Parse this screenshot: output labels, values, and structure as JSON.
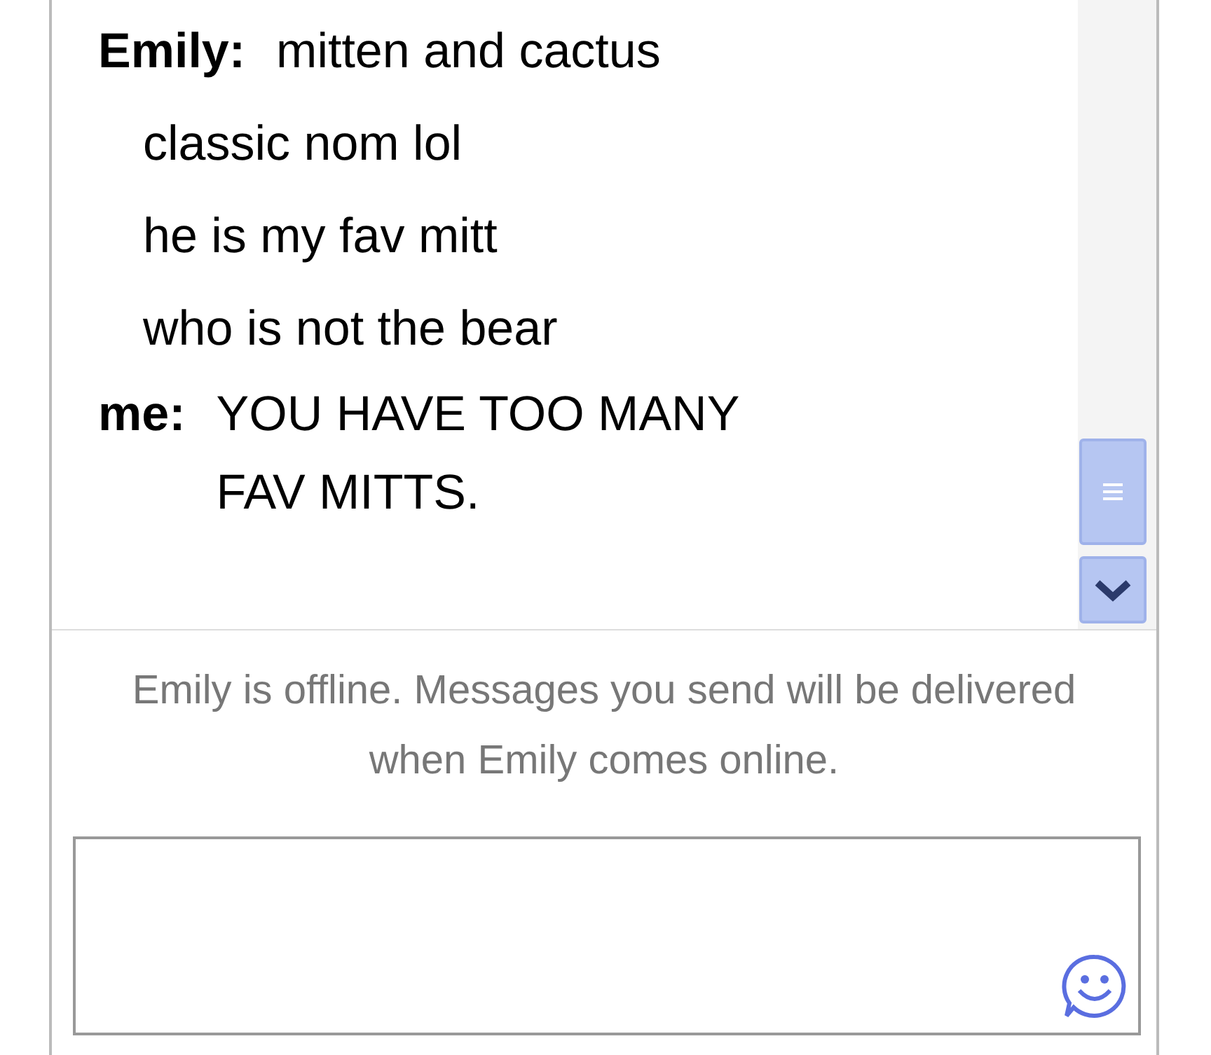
{
  "messages": [
    {
      "sender": "Emily:",
      "lines": [
        "mitten and cactus",
        "classic nom lol",
        "he is my fav mitt",
        "who is not the bear"
      ]
    },
    {
      "sender": "me:",
      "lines": [
        "YOU HAVE TOO MANY FAV MITTS."
      ]
    }
  ],
  "status": "Emily is offline. Messages you send will be delivered when Emily comes online."
}
